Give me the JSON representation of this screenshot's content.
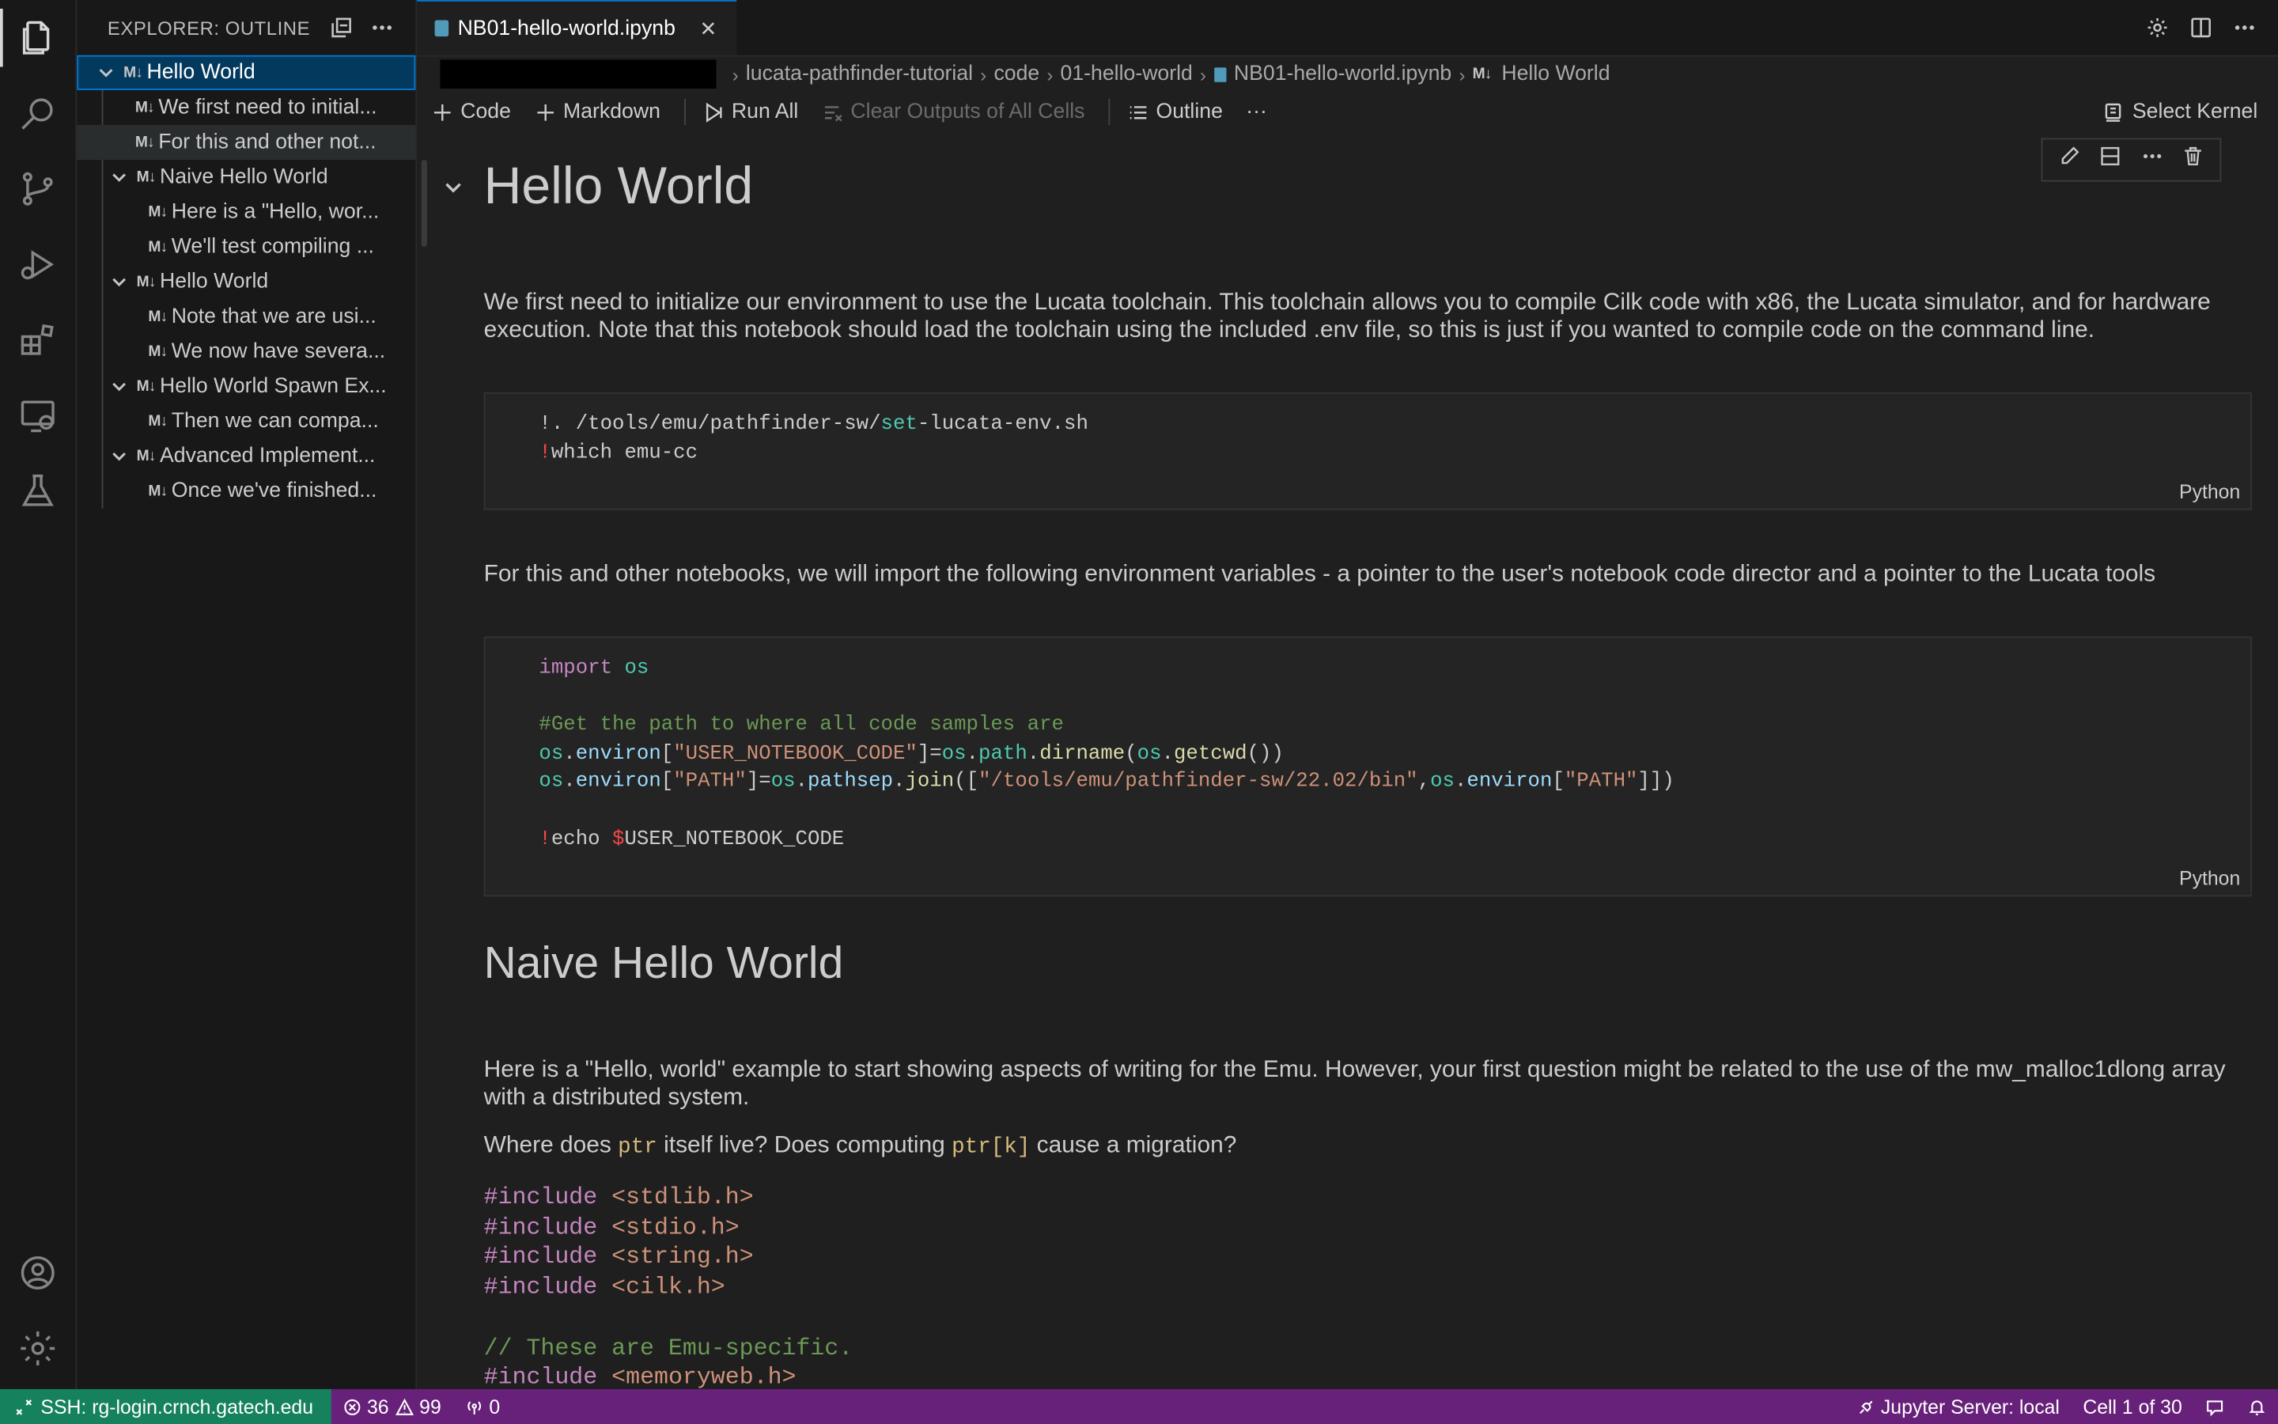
{
  "sidebar": {
    "title": "EXPLORER: OUTLINE",
    "outline": [
      {
        "label": "Hello World",
        "md": "M↓",
        "expanded": true
      },
      {
        "label": "We first need to initial...",
        "md": "M↓"
      },
      {
        "label": "For this and other not...",
        "md": "M↓"
      },
      {
        "label": "Naive Hello World",
        "md": "M↓",
        "expanded": true
      },
      {
        "label": "Here is a \"Hello, wor...",
        "md": "M↓"
      },
      {
        "label": "We'll test compiling ...",
        "md": "M↓"
      },
      {
        "label": "Hello World",
        "md": "M↓",
        "expanded": true
      },
      {
        "label": "Note that we are usi...",
        "md": "M↓"
      },
      {
        "label": "We now have severa...",
        "md": "M↓"
      },
      {
        "label": "Hello World Spawn Ex...",
        "md": "M↓",
        "expanded": true
      },
      {
        "label": "Then we can compa...",
        "md": "M↓"
      },
      {
        "label": "Advanced Implement...",
        "md": "M↓",
        "expanded": true
      },
      {
        "label": "Once we've finished...",
        "md": "M↓"
      }
    ]
  },
  "tab": {
    "label": "NB01-hello-world.ipynb"
  },
  "breadcrumbs": {
    "items": [
      "lucata-pathfinder-tutorial",
      "code",
      "01-hello-world",
      "NB01-hello-world.ipynb",
      "Hello World"
    ],
    "md": "M↓"
  },
  "toolbar": {
    "code": "Code",
    "markdown": "Markdown",
    "run_all": "Run All",
    "clear_outputs": "Clear Outputs of All Cells",
    "outline": "Outline",
    "more": "···",
    "kernel": "Select Kernel"
  },
  "cells": {
    "h1": "Hello World",
    "p1": "We first need to initialize our environment to use the Lucata toolchain. This toolchain allows you to compile Cilk code with x86, the Lucata simulator, and for hardware execution. Note that this notebook should load the toolchain using the included .env file, so this is just if you wanted to compile code on the command line.",
    "code1_lang": "Python",
    "p2": "For this and other notebooks, we will import the following environment variables - a pointer to the user's notebook code director and a pointer to the Lucata tools",
    "code2_lang": "Python",
    "h2": "Naive Hello World",
    "p3": "Here is a \"Hello, world\" example to start showing aspects of writing for the Emu. However, your first question might be related to the use of the mw_malloc1dlong array with a distributed system.",
    "p4_a": "Where does ",
    "p4_code1": "ptr",
    "p4_b": " itself live? Does computing ",
    "p4_code2": "ptr[k]",
    "p4_c": " cause a migration?"
  },
  "code1": {
    "l1_a": "!. /tools/emu/pathfinder-sw/",
    "l1_b": "set",
    "l1_c": "-lucata-env.sh",
    "l2_a": "!",
    "l2_b": "which emu-cc"
  },
  "code2": {
    "l1_a": "import",
    "l1_b": "os",
    "l3": "#Get the path to where all code samples are",
    "l4_a": "os",
    "l4_b": ".",
    "l4_c": "environ",
    "l4_d": "[",
    "l4_e": "\"USER_NOTEBOOK_CODE\"",
    "l4_f": "]=",
    "l4_g": "os",
    "l4_h": ".",
    "l4_i": "path",
    "l4_j": ".",
    "l4_k": "dirname",
    "l4_l": "(",
    "l4_m": "os",
    "l4_n": ".",
    "l4_o": "getcwd",
    "l4_p": "())",
    "l5_a": "os",
    "l5_b": ".",
    "l5_c": "environ",
    "l5_d": "[",
    "l5_e": "\"PATH\"",
    "l5_f": "]=",
    "l5_g": "os",
    "l5_h": ".",
    "l5_i": "pathsep",
    "l5_j": ".",
    "l5_k": "join",
    "l5_l": "([",
    "l5_m": "\"/tools/emu/pathfinder-sw/22.02/bin\"",
    "l5_n": ",",
    "l5_o": "os",
    "l5_p": ".",
    "l5_q": "environ",
    "l5_r": "[",
    "l5_s": "\"PATH\"",
    "l5_t": "]])",
    "l7_a": "!",
    "l7_b": "echo ",
    "l7_c": "$",
    "l7_d": "USER_NOTEBOOK_CODE"
  },
  "code3": {
    "inc": "#include",
    "h1": "<stdlib.h>",
    "h2": "<stdio.h>",
    "h3": "<string.h>",
    "h4": "<cilk.h>",
    "comment": "// These are Emu-specific.",
    "h5": "<memoryweb.h>"
  },
  "status": {
    "remote": "SSH: rg-login.crnch.gatech.edu",
    "errors": "36",
    "warnings": "99",
    "ports": "0",
    "jupyter": "Jupyter Server: local",
    "cell": "Cell 1 of 30"
  },
  "colors": {
    "accent": "#0078d4",
    "statusbar": "#68217a",
    "remote": "#16825d"
  }
}
